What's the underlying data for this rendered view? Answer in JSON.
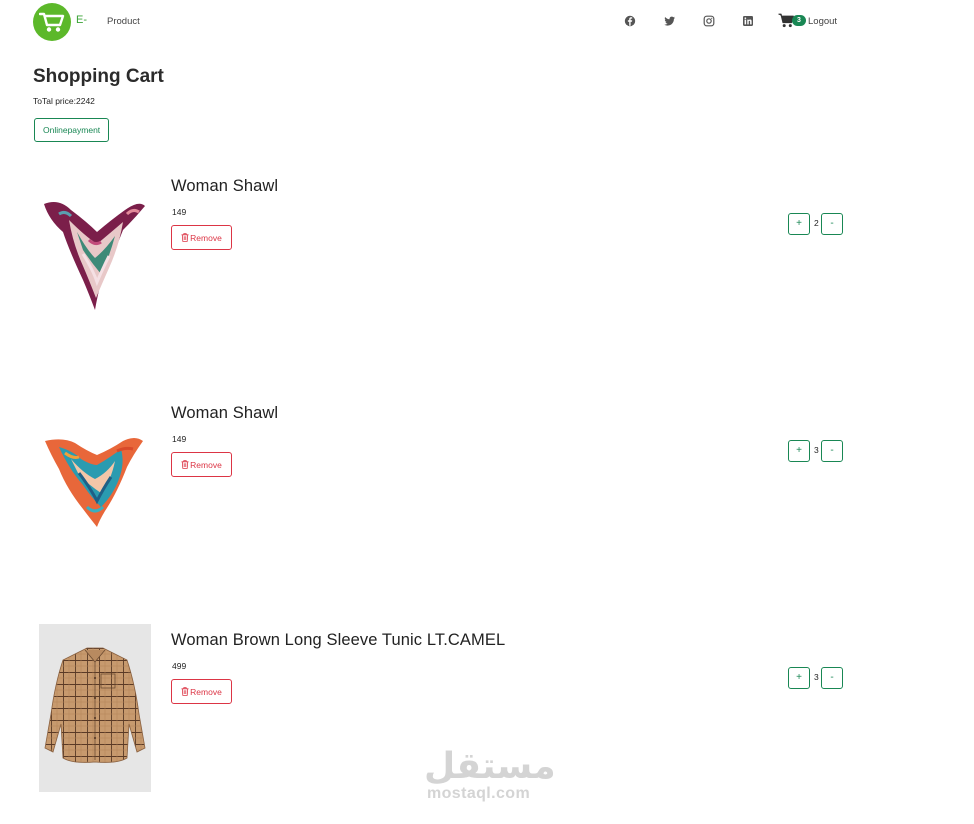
{
  "nav": {
    "brand": "E-",
    "product_link": "Product",
    "cart_count": "3",
    "logout": "Logout",
    "social_icons": [
      "facebook-icon",
      "twitter-icon",
      "instagram-icon",
      "linkedin-icon"
    ]
  },
  "page": {
    "title": "Shopping Cart",
    "total_label": "ToTal price:2242",
    "payment_button": "Onlinepayment"
  },
  "items": [
    {
      "title": "Woman Shawl",
      "price": "149",
      "remove_label": "Remove",
      "qty": "2",
      "plus": "+",
      "minus": "-",
      "image": "shawl-magenta"
    },
    {
      "title": "Woman Shawl",
      "price": "149",
      "remove_label": "Remove",
      "qty": "3",
      "plus": "+",
      "minus": "-",
      "image": "shawl-teal-orange"
    },
    {
      "title": "Woman Brown Long Sleeve Tunic LT.CAMEL",
      "price": "499",
      "remove_label": "Remove",
      "qty": "3",
      "plus": "+",
      "minus": "-",
      "image": "camel-checked-shirt"
    }
  ],
  "watermark": {
    "arabic": "مستقل",
    "latin": "mostaql.com"
  },
  "colors": {
    "brand_green": "#5cb82a",
    "success": "#198754",
    "danger": "#dc3545"
  }
}
